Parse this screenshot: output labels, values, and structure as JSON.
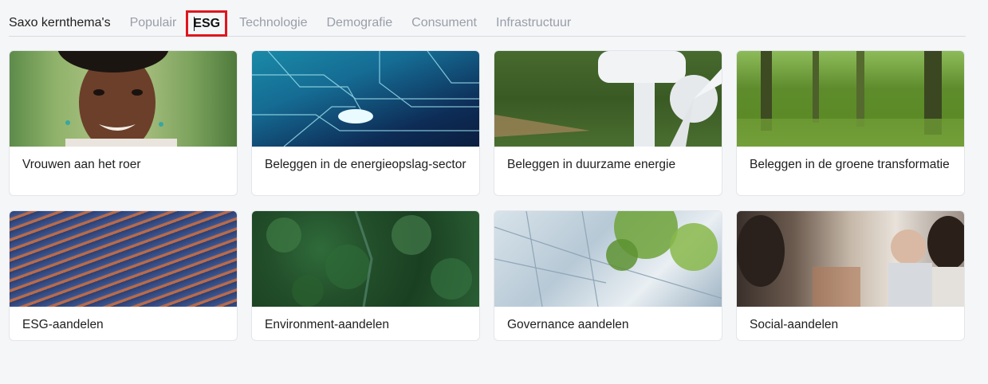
{
  "tabs": {
    "title": "Saxo kernthema's",
    "items": [
      {
        "label": "Populair",
        "active": false
      },
      {
        "label": "ESG",
        "active": true
      },
      {
        "label": "Technologie",
        "active": false
      },
      {
        "label": "Demografie",
        "active": false
      },
      {
        "label": "Consument",
        "active": false
      },
      {
        "label": "Infrastructuur",
        "active": false
      }
    ],
    "active_outline_color": "#e0161e"
  },
  "cards": [
    {
      "title": "Vrouwen aan het roer",
      "image": "portrait-woman"
    },
    {
      "title": "Beleggen in de energieopslag-sector",
      "image": "circuit-board"
    },
    {
      "title": "Beleggen in duurzame energie",
      "image": "wind-turbine"
    },
    {
      "title": "Beleggen in de groene transformatie",
      "image": "forest"
    },
    {
      "title": "ESG-aandelen",
      "image": "solar-farm"
    },
    {
      "title": "Environment-aandelen",
      "image": "forest-canopy"
    },
    {
      "title": "Governance aandelen",
      "image": "glass-building-tree"
    },
    {
      "title": "Social-aandelen",
      "image": "office-meeting"
    }
  ]
}
